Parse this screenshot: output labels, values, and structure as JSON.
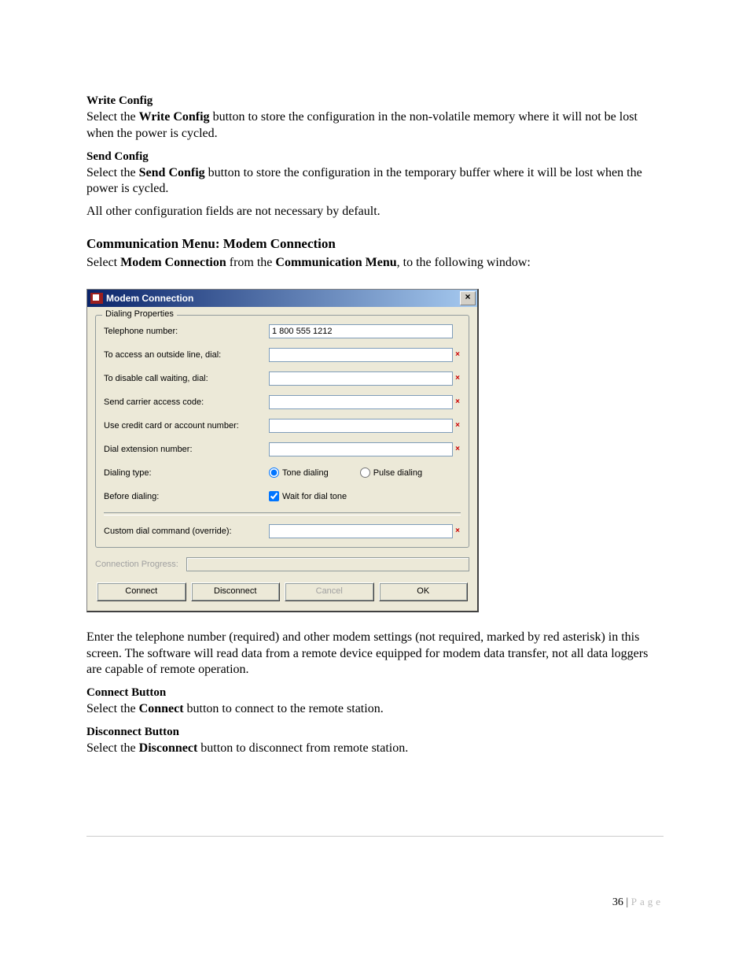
{
  "sections": {
    "write_config": {
      "heading": "Write Config",
      "text_pre": "Select the ",
      "text_bold": "Write Config",
      "text_post": " button to store the configuration in the non-volatile memory where it will not be lost when the power is cycled."
    },
    "send_config": {
      "heading": "Send Config",
      "text_pre": "Select the ",
      "text_bold": "Send Config",
      "text_post": " button to store the configuration in the temporary buffer where it will be lost when the power is cycled.",
      "extra": "All other configuration fields are not necessary by default."
    },
    "comm_heading": "Communication Menu: Modem Connection",
    "comm_intro_pre": "Select ",
    "comm_intro_bold1": "Modem Connection",
    "comm_intro_mid": " from the ",
    "comm_intro_bold2": "Communication Menu",
    "comm_intro_post": ", to the following window:",
    "after_dialog": "Enter the telephone number (required) and other modem settings (not required, marked by red asterisk) in this screen. The software will read data from a remote device equipped for modem data transfer, not all data loggers are capable of remote operation.",
    "connect_button": {
      "heading": "Connect Button",
      "text_pre": "Select the ",
      "text_bold": "Connect",
      "text_post": " button to connect to the remote station."
    },
    "disconnect_button": {
      "heading": "Disconnect Button",
      "text_pre": "Select the ",
      "text_bold": "Disconnect",
      "text_post": " button to disconnect from remote station."
    }
  },
  "dialog": {
    "title": "Modem Connection",
    "close": "×",
    "groupbox_title": "Dialing Properties",
    "fields": {
      "telephone": {
        "label": "Telephone number:",
        "value": "1 800 555 1212"
      },
      "outside": {
        "label": "To access an outside line, dial:",
        "value": ""
      },
      "disable_cw": {
        "label": "To disable call waiting, dial:",
        "value": ""
      },
      "carrier": {
        "label": "Send carrier access code:",
        "value": ""
      },
      "credit": {
        "label": "Use credit card or account number:",
        "value": ""
      },
      "extension": {
        "label": "Dial extension number:",
        "value": ""
      },
      "dialing_type": {
        "label": "Dialing type:",
        "tone": "Tone dialing",
        "pulse": "Pulse dialing"
      },
      "before_dialing": {
        "label": "Before dialing:",
        "wait": "Wait for dial tone"
      },
      "custom": {
        "label": "Custom dial command (override):",
        "value": ""
      }
    },
    "progress_label": "Connection Progress:",
    "buttons": {
      "connect": "Connect",
      "disconnect": "Disconnect",
      "cancel": "Cancel",
      "ok": "OK"
    }
  },
  "footer": {
    "page_number": "36",
    "page_sep": " | ",
    "page_text": "Page"
  }
}
